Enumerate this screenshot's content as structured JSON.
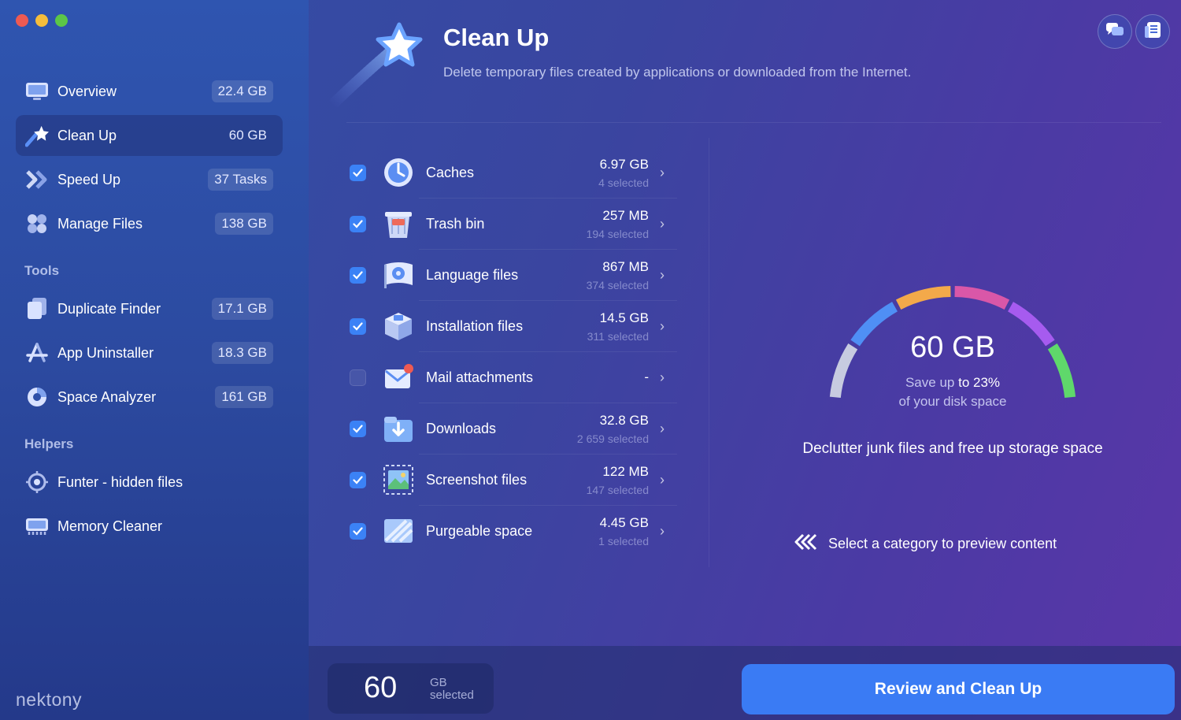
{
  "sidebar": {
    "items": [
      {
        "label": "Overview",
        "badge": "22.4 GB",
        "icon": "monitor-icon"
      },
      {
        "label": "Clean Up",
        "badge": "60 GB",
        "icon": "shooting-star-icon"
      },
      {
        "label": "Speed Up",
        "badge": "37 Tasks",
        "icon": "speed-chevrons-icon"
      },
      {
        "label": "Manage Files",
        "badge": "138 GB",
        "icon": "cubes-icon"
      }
    ],
    "tools_title": "Tools",
    "tools": [
      {
        "label": "Duplicate Finder",
        "badge": "17.1 GB",
        "icon": "duplicate-icon"
      },
      {
        "label": "App Uninstaller",
        "badge": "18.3 GB",
        "icon": "app-store-icon"
      },
      {
        "label": "Space Analyzer",
        "badge": "161 GB",
        "icon": "pie-chart-icon"
      }
    ],
    "helpers_title": "Helpers",
    "helpers": [
      {
        "label": "Funter - hidden files",
        "icon": "eye-target-icon"
      },
      {
        "label": "Memory Cleaner",
        "icon": "memory-chip-icon"
      }
    ],
    "brand": "nektony"
  },
  "header": {
    "title": "Clean Up",
    "subtitle": "Delete temporary files created by applications or downloaded from the Internet."
  },
  "categories": [
    {
      "label": "Caches",
      "size": "6.97 GB",
      "selected": "4 selected",
      "checked": true,
      "icon": "caches-icon"
    },
    {
      "label": "Trash bin",
      "size": "257 MB",
      "selected": "194 selected",
      "checked": true,
      "icon": "trash-icon"
    },
    {
      "label": "Language files",
      "size": "867 MB",
      "selected": "374 selected",
      "checked": true,
      "icon": "language-flag-icon"
    },
    {
      "label": "Installation files",
      "size": "14.5 GB",
      "selected": "311 selected",
      "checked": true,
      "icon": "package-icon"
    },
    {
      "label": "Mail attachments",
      "size": "-",
      "selected": "",
      "checked": false,
      "icon": "mail-icon"
    },
    {
      "label": "Downloads",
      "size": "32.8 GB",
      "selected": "2 659 selected",
      "checked": true,
      "icon": "downloads-icon"
    },
    {
      "label": "Screenshot files",
      "size": "122 MB",
      "selected": "147 selected",
      "checked": true,
      "icon": "screenshot-icon"
    },
    {
      "label": "Purgeable space",
      "size": "4.45 GB",
      "selected": "1 selected",
      "checked": true,
      "icon": "purgeable-icon"
    }
  ],
  "gauge": {
    "value": "60 GB",
    "save_prefix": "Save up",
    "save_value": "to 23%",
    "save_line2": "of your disk space",
    "percent": 23,
    "colors": [
      "#c7cbe0",
      "#4f8ff5",
      "#f3a94a",
      "#d957a8",
      "#a65bef",
      "#5fd86b"
    ]
  },
  "declutter": "Declutter junk files and free up storage space",
  "hint": "Select a category to preview content",
  "footer": {
    "selected_value": "60",
    "selected_unit": "GB",
    "selected_label": "selected",
    "cta_label": "Review and Clean Up"
  }
}
